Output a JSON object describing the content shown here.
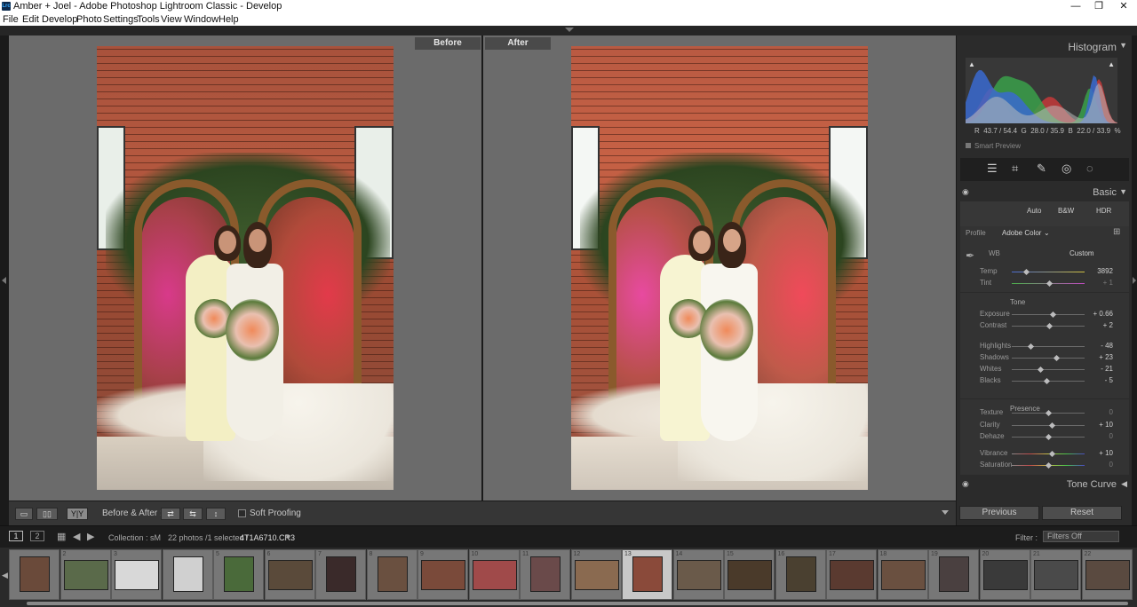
{
  "window": {
    "title": "Amber + Joel - Adobe Photoshop Lightroom Classic - Develop",
    "app_icon": "Lrc",
    "minimize": "—",
    "restore": "❐",
    "close": "✕"
  },
  "menu": [
    "File",
    "Edit",
    "Develop",
    "Photo",
    "Settings",
    "Tools",
    "View",
    "Window",
    "Help"
  ],
  "compare": {
    "before_label": "Before",
    "after_label": "After"
  },
  "toolbar": {
    "before_after_label": "Before & After :",
    "yy_label": "Y|Y",
    "soft_proofing": "Soft Proofing"
  },
  "histogram": {
    "title": "Histogram",
    "rgb": {
      "r_label": "R",
      "r": "43.7 / 54.4",
      "g_label": "G",
      "g": "28.0 / 35.9",
      "b_label": "B",
      "b": "22.0 / 33.9",
      "unit": "%"
    },
    "smart_preview": "Smart Preview"
  },
  "basic": {
    "title": "Basic",
    "modes": [
      "Auto",
      "B&W",
      "HDR"
    ],
    "profile_label": "Profile",
    "profile_value": "Adobe Color",
    "wb_label": "WB",
    "wb_value": "Custom",
    "tone_label": "Tone",
    "presence_label": "Presence",
    "sliders": [
      {
        "name": "Temp",
        "value": "3892",
        "pos": 0.2
      },
      {
        "name": "Tint",
        "value": "+ 1",
        "pos": 0.51
      },
      {
        "name": "Exposure",
        "value": "+ 0.66",
        "pos": 0.56
      },
      {
        "name": "Contrast",
        "value": "+ 2",
        "pos": 0.51
      },
      {
        "name": "Highlights",
        "value": "- 48",
        "pos": 0.26
      },
      {
        "name": "Shadows",
        "value": "+ 23",
        "pos": 0.61
      },
      {
        "name": "Whites",
        "value": "- 21",
        "pos": 0.39
      },
      {
        "name": "Blacks",
        "value": "- 5",
        "pos": 0.47
      },
      {
        "name": "Texture",
        "value": "0",
        "pos": 0.5
      },
      {
        "name": "Clarity",
        "value": "+ 10",
        "pos": 0.55
      },
      {
        "name": "Dehaze",
        "value": "0",
        "pos": 0.5
      },
      {
        "name": "Vibrance",
        "value": "+ 10",
        "pos": 0.55
      },
      {
        "name": "Saturation",
        "value": "0",
        "pos": 0.5
      }
    ]
  },
  "tone_curve": {
    "title": "Tone Curve"
  },
  "buttons": {
    "previous": "Previous",
    "reset": "Reset"
  },
  "filmstrip_bar": {
    "page1": "1",
    "page2": "2",
    "collection": "Collection : sM",
    "count": "22 photos /1 selected /",
    "filename": "4T1A6710.CR3",
    "filter_label": "Filter :",
    "filter_value": "Filters Off"
  },
  "filmstrip": [
    "",
    "2",
    "3",
    "",
    "5",
    "6",
    "7",
    "8",
    "9",
    "10",
    "11",
    "12",
    "13",
    "14",
    "15",
    "16",
    "17",
    "18",
    "19",
    "20",
    "21",
    "22"
  ],
  "colors": {
    "accent_selected": "#c8c8c8",
    "panel_bg": "#2b2b2b"
  }
}
